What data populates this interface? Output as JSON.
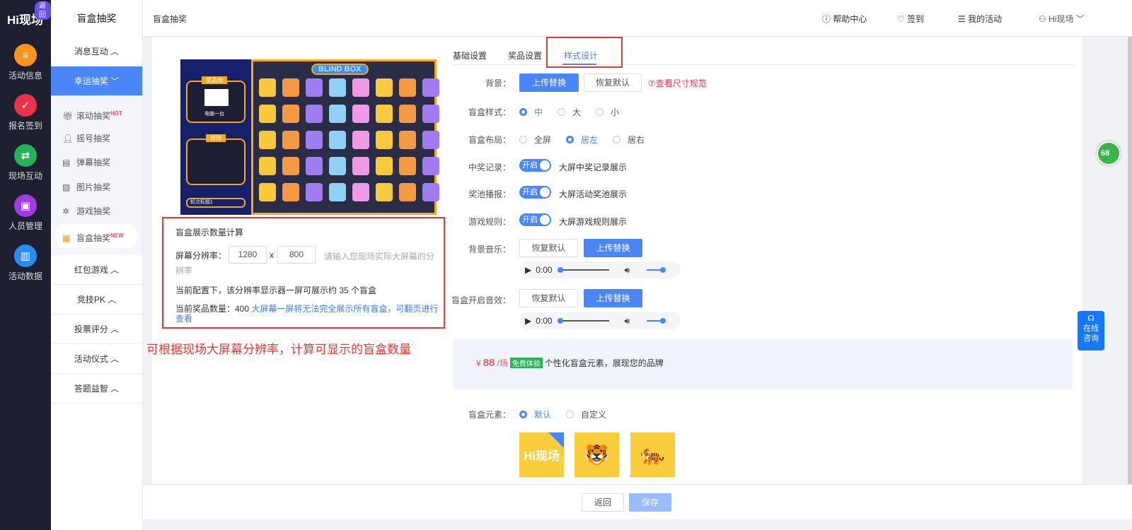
{
  "rail": {
    "logo": "Hi现场",
    "back": "返回",
    "items": [
      {
        "label": "活动信息",
        "icon": "document-icon",
        "color": "#f7941d"
      },
      {
        "label": "报名签到",
        "icon": "calendar-check-icon",
        "color": "#e8334a"
      },
      {
        "label": "现场互动",
        "icon": "interact-icon",
        "color": "#23b45a"
      },
      {
        "label": "人员管理",
        "icon": "person-card-icon",
        "color": "#a23be0"
      },
      {
        "label": "活动数据",
        "icon": "bar-chart-icon",
        "color": "#2a8cf0"
      }
    ]
  },
  "nav": {
    "title": "盲盒抽奖",
    "group_msg": "消息互动",
    "group_lucky": "幸运抽奖",
    "sub": [
      {
        "label": "滚动抽奖",
        "badge": "HOT"
      },
      {
        "label": "摇号抽奖",
        "badge": ""
      },
      {
        "label": "弹幕抽奖",
        "badge": ""
      },
      {
        "label": "图片抽奖",
        "badge": ""
      },
      {
        "label": "游戏抽奖",
        "badge": ""
      },
      {
        "label": "盲盒抽奖",
        "badge": "NEW"
      }
    ],
    "groups": [
      "红包游戏",
      "竞技PK",
      "投票评分",
      "活动仪式",
      "答题益智"
    ]
  },
  "header": {
    "title": "盲盒抽奖",
    "help": "帮助中心",
    "checkin": "签到",
    "my_activity": "我的活动",
    "user": "Hi现场"
  },
  "preview": {
    "banner": "BLIND BOX",
    "prize_title": "奖品池",
    "prize_name": "电脑一台",
    "rules_title": "规则",
    "round_select": "轮次标题1"
  },
  "calc": {
    "title": "盲盒展示数量计算",
    "res_label": "屏幕分辨率：",
    "width": "1280",
    "x": "x",
    "height": "800",
    "hint": "请输入您现场实际大屏幕的分辨率",
    "line1": "当前配置下，该分辨率显示器一屏可展示约 35 个盲盒",
    "line2_prefix": "当前奖品数量：400",
    "line2_link": "大屏幕一屏将无法完全展示所有盲盒，可翻页进行查看"
  },
  "annotation": "可根据现场大屏幕分辨率，计算可显示的盲盒数量",
  "tabs": [
    "基础设置",
    "奖品设置",
    "样式设计"
  ],
  "form": {
    "bg_label": "背景：",
    "upload": "上传替换",
    "reset": "恢复默认",
    "size_link": "查看尺寸规范",
    "style_label": "盲盒样式：",
    "style_opts": [
      "中",
      "大",
      "小"
    ],
    "layout_label": "盲盒布局：",
    "layout_opts": [
      "全屏",
      "居左",
      "居右"
    ],
    "record_label": "中奖记录：",
    "record_desc": "大屏中奖记录展示",
    "pool_label": "奖池播报：",
    "pool_desc": "大屏活动奖池展示",
    "rules_label": "游戏规则：",
    "rules_desc": "大屏游戏规则展示",
    "switch_on": "开启",
    "music_label": "背景音乐：",
    "sound_label": "盲盒开启音效：",
    "time": "0:00"
  },
  "promo": {
    "currency": "¥",
    "price": "88",
    "unit": "/场",
    "tag": "免费体验",
    "desc": "个性化盲盒元素，展现您的品牌"
  },
  "elements": {
    "label": "盲盒元素：",
    "opts": [
      "默认",
      "自定义"
    ],
    "thumb1": "Hi现场"
  },
  "footer": {
    "back": "返回",
    "save": "保存"
  },
  "float": {
    "badge": "68",
    "consult": "在线咨询"
  }
}
